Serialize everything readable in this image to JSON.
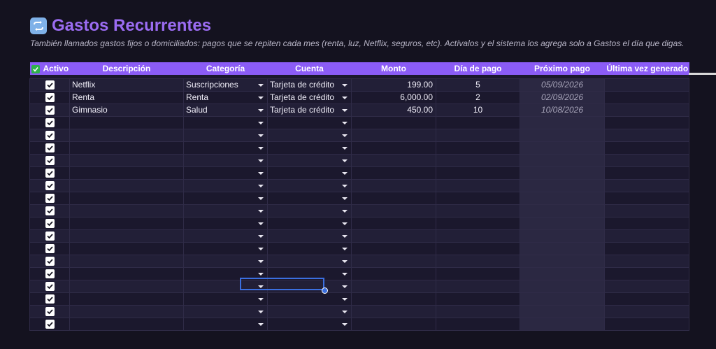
{
  "header": {
    "title": "Gastos Recurrentes",
    "icon": "repeat-icon",
    "subtitle": "También llamados gastos fijos o domiciliados: pagos que se repiten cada mes (renta, luz, Netflix, seguros, etc). Actívalos y el sistema los agrega solo a Gastos el día que digas."
  },
  "table": {
    "columns": [
      "Activo",
      "Descripción",
      "Categoría",
      "Cuenta",
      "Monto",
      "Día de pago",
      "Próximo pago",
      "Última vez generado"
    ],
    "rows": [
      {
        "active": true,
        "descripcion": "Netflix",
        "categoria": "Suscripciones",
        "cuenta": "Tarjeta de crédito",
        "monto": "199.00",
        "dia": "5",
        "proximo": "05/09/2026",
        "ultima": ""
      },
      {
        "active": true,
        "descripcion": "Renta",
        "categoria": "Renta",
        "cuenta": "Tarjeta de crédito",
        "monto": "6,000.00",
        "dia": "2",
        "proximo": "02/09/2026",
        "ultima": ""
      },
      {
        "active": true,
        "descripcion": "Gimnasio",
        "categoria": "Salud",
        "cuenta": "Tarjeta de crédito",
        "monto": "450.00",
        "dia": "10",
        "proximo": "10/08/2026",
        "ultima": ""
      }
    ],
    "empty_rows": 17
  },
  "colors": {
    "accent": "#8b5cf6",
    "title": "#9b6cf2",
    "background": "#14121f",
    "selection": "#3b6fe0"
  }
}
